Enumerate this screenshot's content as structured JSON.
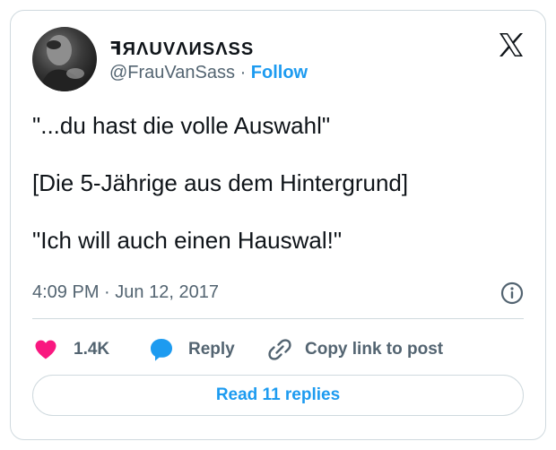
{
  "tweet": {
    "display_name": "ꟻЯΛUVΛИSΛSS",
    "handle": "@FrauVanSass",
    "separator": "·",
    "follow_label": "Follow",
    "text_lines": [
      "\"...du hast die volle Auswahl\"",
      "",
      "[Die 5-Jährige aus dem Hintergrund]",
      "",
      "\"Ich will auch einen Hauswal!\""
    ],
    "time": "4:09 PM",
    "date": "Jun 12, 2017",
    "date_separator": "·"
  },
  "actions": {
    "likes": "1.4K",
    "reply_label": "Reply",
    "copy_label": "Copy link to post"
  },
  "read_replies_label": "Read 11 replies",
  "colors": {
    "accent": "#1d9bf0",
    "like": "#f91880",
    "reply_bubble": "#1d9bf0",
    "text": "#0f1419",
    "muted": "#536471",
    "border": "#cfd9de"
  },
  "icons": {
    "avatar": "avatar-photo",
    "logo": "x-logo-icon",
    "info": "info-icon",
    "like": "heart-icon",
    "reply": "speech-bubble-icon",
    "copy": "link-icon"
  }
}
